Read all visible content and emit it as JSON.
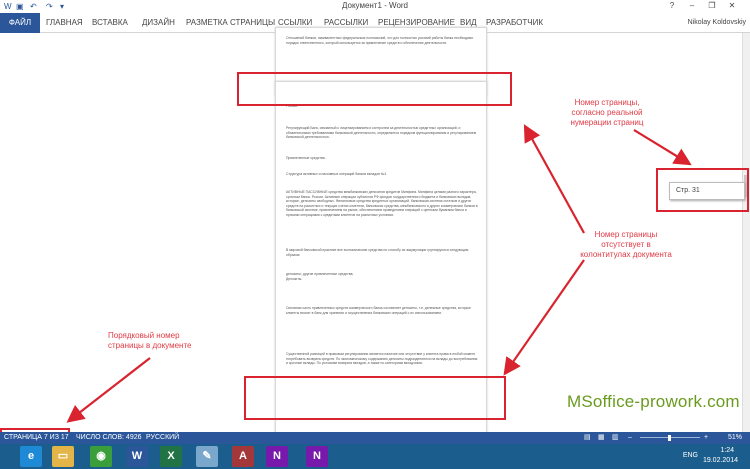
{
  "window": {
    "title": "Документ1 - Word",
    "help_label": "?",
    "minimize_label": "–",
    "restore_label": "❐",
    "close_label": "✕"
  },
  "ribbon": {
    "file_tab": "ФАЙЛ",
    "tabs": [
      "ГЛАВНАЯ",
      "ВСТАВКА",
      "ДИЗАЙН",
      "РАЗМЕТКА СТРАНИЦЫ",
      "ССЫЛКИ",
      "РАССЫЛКИ",
      "РЕЦЕНЗИРОВАНИЕ",
      "ВИД",
      "РАЗРАБОТЧИК"
    ],
    "user": "Nikolay Koldovskiy"
  },
  "document": {
    "page1_text": "Отношений банков, эквивалентных федеральным полномочий, что для полностью условий работы банка необходимо порядок ответственного, который используется за привлечение средств и обеспечение деятельности.",
    "page2_paragraphs": [
      "России.",
      "Регулирующий Банк, связанный с лицензированием и контролем за деятельностью кредитных организаций, и обязательными требованиями банковской деятельности, определяется порядком функционирования и регулированием банковской деятельностью.",
      "Привлеченные средства.",
      "Структура активных и пассивных операций банков вкладов №1",
      "АКТИВНЫЕ ПАССИВНЫЕ средства межбанковских депозитов кредитов Минфина. Минфина целями разного характера, срочным банка. России. Активные операции субъектов РФ фондов государственного бюджета и банковских вкладов, которые, депозиты свободных. Финансовые средства кредитных организаций, банковская система остатков и других средств на расчетных и текущих счетах клиентов, банковских средства, межбанковского и других коммерческих банков в банковской системе, привлечением на рынке, обеспечением проведением операций с ценными бумагами банка и прочими операциями с кредитами клиентов на различных условиях.",
      "В мировой банковской практике все экономические средства по способу их аккумуляции группируются следующим образом:",
      "депозиты; другие привлеченные средства; Депозиты.",
      "Основная часть привлеченных средств коммерческого банка составляет депозиты, т.е. денежные средства, которые клиенты вносят в банк для хранения и осуществления банковских операций с их использованием.",
      "Существенной разницей в правовом регулировании является наличие или отсутствие у клиента права в любой момент потребовать возврата средств. По экономическому содержанию депозиты подразделяются на вклады до востребования и срочные вклады. По условиям возврата вкладов, а также по категориям вкладчиков."
    ]
  },
  "tooltip": "Стр. 31",
  "annotations": {
    "note_page_real": "Номер страницы, согласно реальной нумерации страниц",
    "note_header_missing": "Номер страницы отсутствует в колонтитулах документа",
    "note_ordinal": "Порядковый номер страницы в документе"
  },
  "watermark": "MSoffice-prowork.com",
  "statusbar": {
    "page": "СТРАНИЦА 7 ИЗ 17",
    "words": "ЧИСЛО СЛОВ: 4926",
    "language": "РУССКИЙ",
    "zoom": "51%"
  },
  "taskbar": {
    "apps": [
      "IE",
      "Explorer",
      "Chrome",
      "Word",
      "Excel",
      "Paint",
      "Access",
      "OneNote",
      "OneNote 2"
    ],
    "language": "ENG",
    "time": "1:24",
    "date": "19.02.2014"
  },
  "colors": {
    "accent": "#2b579a",
    "annotation": "#d9232e",
    "watermark": "#6a9a1f"
  }
}
